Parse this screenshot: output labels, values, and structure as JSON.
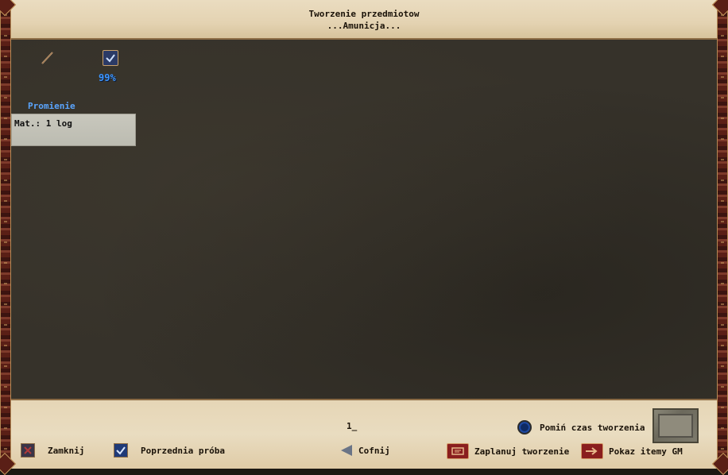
{
  "window": {
    "title": "Tworzenie przedmiotow",
    "subtitle": "...Amunicja..."
  },
  "item": {
    "icon": "arrow-shaft-icon",
    "status_icon": "check-icon",
    "success_rate": "99%",
    "name": "Promienie",
    "materials": "Mat.: 1 log"
  },
  "footer": {
    "quantity": "1_",
    "skip_time_label": "Pomiń czas tworzenia",
    "close_label": "Zamknij",
    "previous_label": "Poprzednia próba",
    "back_label": "Cofnij",
    "schedule_label": "Zaplanuj tworzenie",
    "show_gm_label": "Pokaz itemy GM"
  },
  "colors": {
    "accent": "#3c95ff",
    "main_bg": "#36322a",
    "parchment": "#e6d6b6",
    "border_red": "#5a1f16"
  }
}
